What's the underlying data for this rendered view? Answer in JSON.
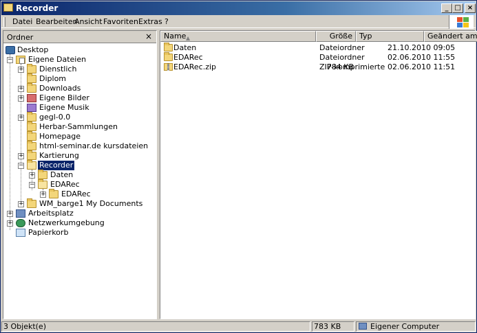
{
  "window": {
    "title": "Recorder"
  },
  "menu": [
    "Datei",
    "Bearbeiten",
    "Ansicht",
    "Favoriten",
    "Extras",
    "?"
  ],
  "title_buttons": {
    "minimize": "_",
    "maximize": "□",
    "close": "×"
  },
  "folders_pane": {
    "title": "Ordner",
    "close": "×"
  },
  "tree": [
    {
      "label": "Desktop",
      "icon": "desktop-icon"
    },
    {
      "label": "Eigene Dateien",
      "icon": "my-documents-icon",
      "expander": "−"
    },
    {
      "label": "Dienstlich",
      "icon": "folder-icon",
      "expander": "+"
    },
    {
      "label": "Diplom",
      "icon": "folder-icon"
    },
    {
      "label": "Downloads",
      "icon": "folder-icon",
      "expander": "+"
    },
    {
      "label": "Eigene Bilder",
      "icon": "my-pictures-icon",
      "expander": "+"
    },
    {
      "label": "Eigene Musik",
      "icon": "my-music-icon"
    },
    {
      "label": "gegl-0.0",
      "icon": "folder-icon",
      "expander": "+"
    },
    {
      "label": "Herbar-Sammlungen",
      "icon": "folder-icon"
    },
    {
      "label": "Homepage",
      "icon": "folder-icon"
    },
    {
      "label": "html-seminar.de kursdateien",
      "icon": "folder-icon"
    },
    {
      "label": "Kartierung",
      "icon": "folder-icon",
      "expander": "+"
    },
    {
      "label": "Recorder",
      "icon": "folder-open-icon",
      "expander": "−",
      "selected": true
    },
    {
      "label": "Daten",
      "icon": "folder-icon",
      "expander": "+"
    },
    {
      "label": "EDARec",
      "icon": "folder-open-icon",
      "expander": "−"
    },
    {
      "label": "EDARec",
      "icon": "folder-icon",
      "expander": "+"
    },
    {
      "label": "WM_barge1 My Documents",
      "icon": "folder-icon",
      "expander": "+"
    },
    {
      "label": "Arbeitsplatz",
      "icon": "computer-icon",
      "expander": "+"
    },
    {
      "label": "Netzwerkumgebung",
      "icon": "network-icon",
      "expander": "+"
    },
    {
      "label": "Papierkorb",
      "icon": "recycle-bin-icon"
    }
  ],
  "columns": {
    "name": "Name",
    "size": "Größe",
    "type": "Typ",
    "date": "Geändert am"
  },
  "files": [
    {
      "name": "Daten",
      "size": "",
      "type": "Dateiordner",
      "date": "21.10.2010 09:05",
      "icon": "folder-icon"
    },
    {
      "name": "EDARec",
      "size": "",
      "type": "Dateiordner",
      "date": "02.06.2010 11:55",
      "icon": "folder-icon"
    },
    {
      "name": "EDARec.zip",
      "size": "784 KB",
      "type": "ZIP-komprimierter O...",
      "date": "02.06.2010 11:51",
      "icon": "zip-icon"
    }
  ],
  "status": {
    "count": "3 Objekt(e)",
    "size": "783 KB",
    "zone": "Eigener Computer"
  },
  "colors": {
    "title_active": "#0a246a",
    "face": "#d4d0c8",
    "selection": "#0a246a"
  }
}
